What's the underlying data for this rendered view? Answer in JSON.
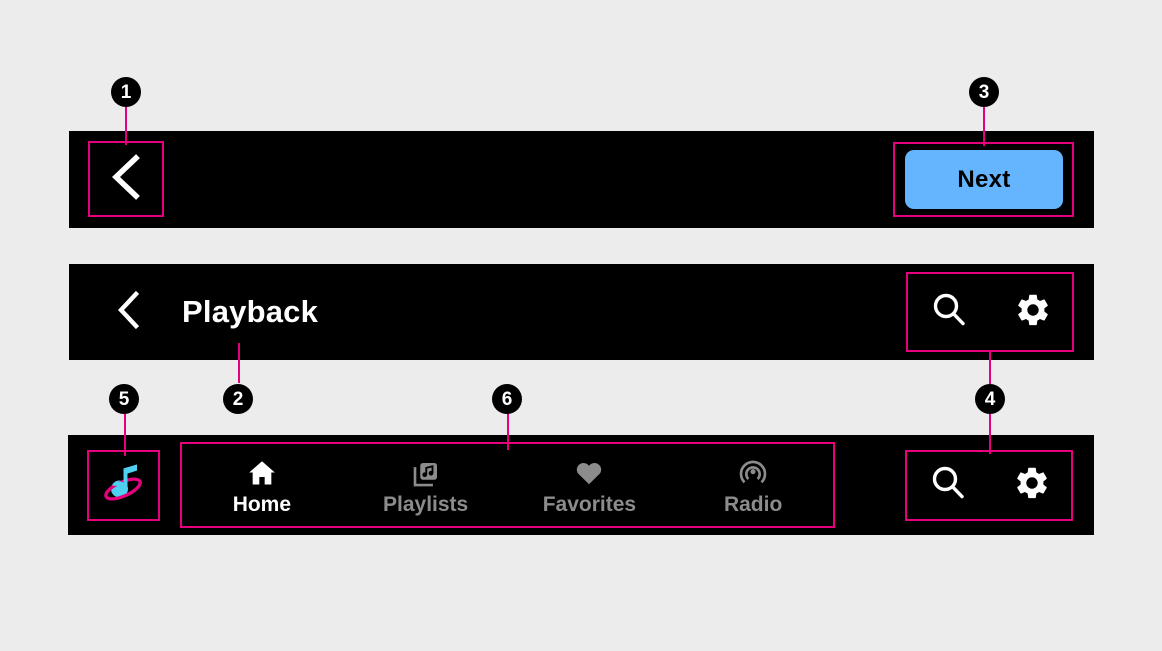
{
  "background_color": "#ececec",
  "bar_color": "#000000",
  "accent_color": "#e6007e",
  "top_toolbar": {
    "back_icon": "chevron-left-icon",
    "next_label": "Next",
    "next_color": "#64b5fd"
  },
  "playback_header": {
    "back_icon": "chevron-left-icon",
    "title": "Playback",
    "actions": [
      {
        "icon": "search-icon"
      },
      {
        "icon": "gear-icon"
      }
    ]
  },
  "bottom_bar": {
    "logo_icon": "music-note-orbit-logo",
    "logo_note_color": "#4fd0f0",
    "logo_ring_color": "#e6007e",
    "nav_items": [
      {
        "label": "Home",
        "icon": "home-icon",
        "active": true
      },
      {
        "label": "Playlists",
        "icon": "library-music-icon",
        "active": false
      },
      {
        "label": "Favorites",
        "icon": "heart-icon",
        "active": false
      },
      {
        "label": "Radio",
        "icon": "radio-waves-icon",
        "active": false
      }
    ],
    "actions": [
      {
        "icon": "search-icon"
      },
      {
        "icon": "gear-icon"
      }
    ]
  },
  "annotations": [
    {
      "number": "1",
      "target": "top-toolbar-back-button"
    },
    {
      "number": "2",
      "target": "playback-title"
    },
    {
      "number": "3",
      "target": "next-button"
    },
    {
      "number": "4",
      "target": "header-and-bottom-action-icons"
    },
    {
      "number": "5",
      "target": "brand-logo"
    },
    {
      "number": "6",
      "target": "bottom-nav-items"
    }
  ]
}
